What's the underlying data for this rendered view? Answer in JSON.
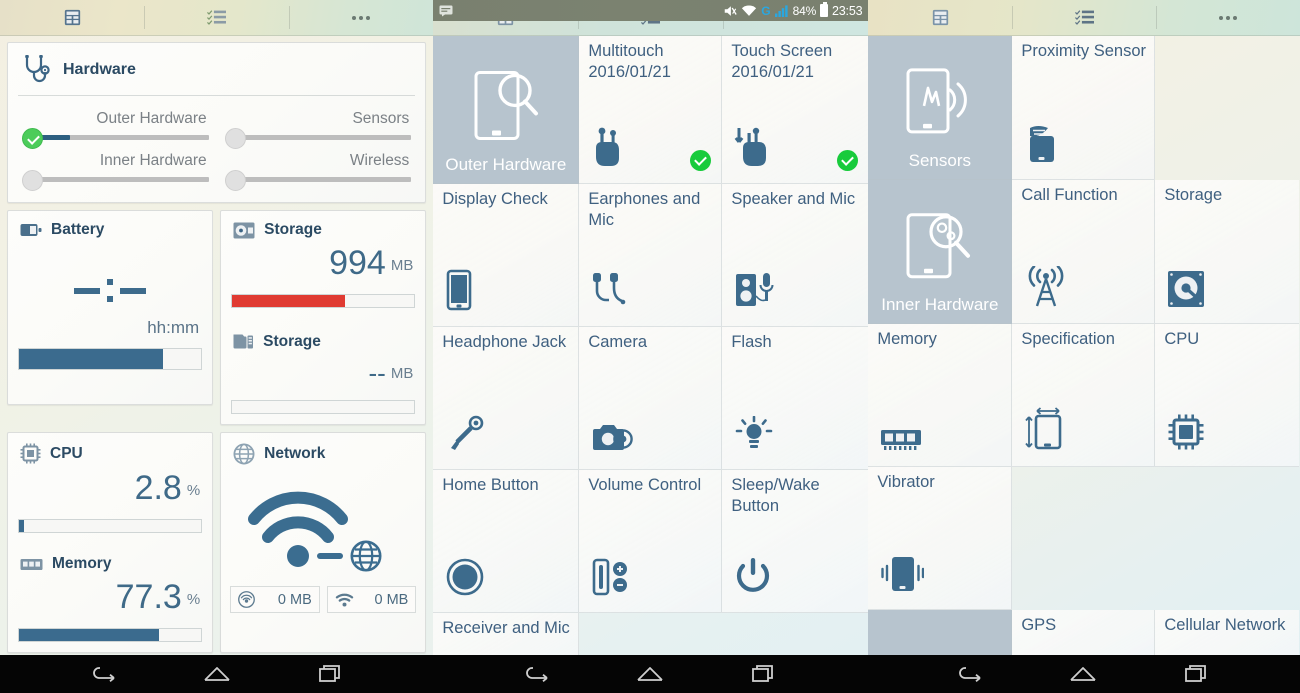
{
  "actionbar": {
    "icons": [
      "table-view-icon",
      "checklist-icon",
      "overflow-menu-icon"
    ]
  },
  "statusbar": {
    "mute_icon": "mute-icon",
    "wifi_icon": "wifi-icon",
    "data_icon": "mobile-data-g-icon",
    "signal_icon": "cell-signal-icon",
    "battery_percent": "84%",
    "battery_icon": "battery-icon",
    "clock": "23:53"
  },
  "dashboard": {
    "hardware": {
      "icon": "stethoscope-icon",
      "title": "Hardware",
      "sliders": [
        {
          "label": "Outer Hardware",
          "on": true,
          "fill_pct": 17
        },
        {
          "label": "Sensors",
          "on": false,
          "fill_pct": 0
        },
        {
          "label": "Inner Hardware",
          "on": false,
          "fill_pct": 0
        },
        {
          "label": "Wireless",
          "on": false,
          "fill_pct": 0
        }
      ]
    },
    "battery": {
      "icon": "battery-icon",
      "title": "Battery",
      "value": "--:--",
      "unit": "hh:mm",
      "progress_pct": 79
    },
    "storage_internal": {
      "icon": "disc-storage-icon",
      "title": "Storage",
      "value": "994",
      "unit": "MB",
      "progress_pct": 62
    },
    "storage_sd": {
      "icon": "sdcard-storage-icon",
      "title": "Storage",
      "value": "--",
      "unit": "MB",
      "progress_pct": 0
    },
    "cpu": {
      "icon": "cpu-chip-icon",
      "title": "CPU",
      "value": "2.8",
      "unit": "%",
      "progress_pct": 2.8
    },
    "memory": {
      "icon": "memory-ram-icon",
      "title": "Memory",
      "value": "77.3",
      "unit": "%",
      "progress_pct": 77.3
    },
    "network": {
      "icon": "globe-icon",
      "title": "Network",
      "graphic": "wifi-connected-to-globe-icon",
      "stats": [
        {
          "icon": "mobile-data-icon",
          "value": "0 MB"
        },
        {
          "icon": "wifi-icon",
          "value": "0 MB"
        }
      ]
    }
  },
  "outer_hardware_panel": {
    "category": {
      "label": "Outer Hardware",
      "icon": "phone-magnifier-icon"
    },
    "tiles": [
      {
        "label": "Multitouch\n2016/01/21",
        "icon": "multitouch-hand-icon",
        "status": "ok"
      },
      {
        "label": "Touch Screen\n2016/01/21",
        "icon": "touch-screen-hand-icon",
        "status": "ok"
      },
      {
        "label": "Display Check",
        "icon": "tablet-display-icon",
        "status": ""
      },
      {
        "label": "Earphones and Mic",
        "icon": "earphones-icon",
        "status": ""
      },
      {
        "label": "Speaker and Mic",
        "icon": "speaker-mic-icon",
        "status": ""
      },
      {
        "label": "Headphone Jack",
        "icon": "headphone-jack-icon",
        "status": ""
      },
      {
        "label": "Camera",
        "icon": "camera-icon",
        "status": ""
      },
      {
        "label": "Flash",
        "icon": "flash-light-icon",
        "status": ""
      },
      {
        "label": "Home Button",
        "icon": "home-button-icon",
        "status": ""
      },
      {
        "label": "Volume Control",
        "icon": "volume-rocker-icon",
        "status": ""
      },
      {
        "label": "Sleep/Wake Button",
        "icon": "power-button-icon",
        "status": ""
      },
      {
        "label": "Receiver and Mic",
        "icon": "",
        "status": ""
      }
    ],
    "labels": {
      "multitouch": "Multitouch",
      "multitouch_date": "2016/01/21",
      "touchscreen": "Touch Screen",
      "touchscreen_date": "2016/01/21",
      "display_check": "Display Check",
      "earphones_and_mic": "Earphones and Mic",
      "speaker_and_mic": "Speaker and Mic",
      "headphone_jack": "Headphone Jack",
      "camera": "Camera",
      "flash": "Flash",
      "home_button": "Home Button",
      "volume_control": "Volume Control",
      "sleep_wake_button": "Sleep/Wake Button",
      "receiver_and_mic": "Receiver and Mic"
    }
  },
  "sensors_panel": {
    "categories": [
      {
        "label": "Sensors",
        "icon": "phone-sensor-waves-icon"
      },
      {
        "label": "Inner Hardware",
        "icon": "phone-gears-magnifier-icon"
      }
    ],
    "labels": {
      "proximity_sensor": "Proximity Sensor",
      "call_function": "Call Function",
      "storage": "Storage",
      "memory": "Memory",
      "specification": "Specification",
      "cpu": "CPU",
      "vibrator": "Vibrator",
      "gps": "GPS",
      "cellular_network": "Cellular Network"
    },
    "icons": {
      "proximity_sensor": "proximity-phone-icon",
      "call_function": "cell-tower-icon",
      "storage": "hard-disk-icon",
      "memory": "memory-ram-icon",
      "specification": "device-dimensions-icon",
      "cpu": "cpu-chip-icon",
      "vibrator": "vibrating-phone-icon"
    }
  },
  "navbar": {
    "buttons": [
      "back-button",
      "home-button",
      "recent-apps-button"
    ]
  },
  "colors": {
    "accent": "#33648a",
    "ok_green": "#18cb3c",
    "alert_red": "#e03b32",
    "category_tile": "#b7c4ce",
    "title_text": "#2b4a63"
  }
}
